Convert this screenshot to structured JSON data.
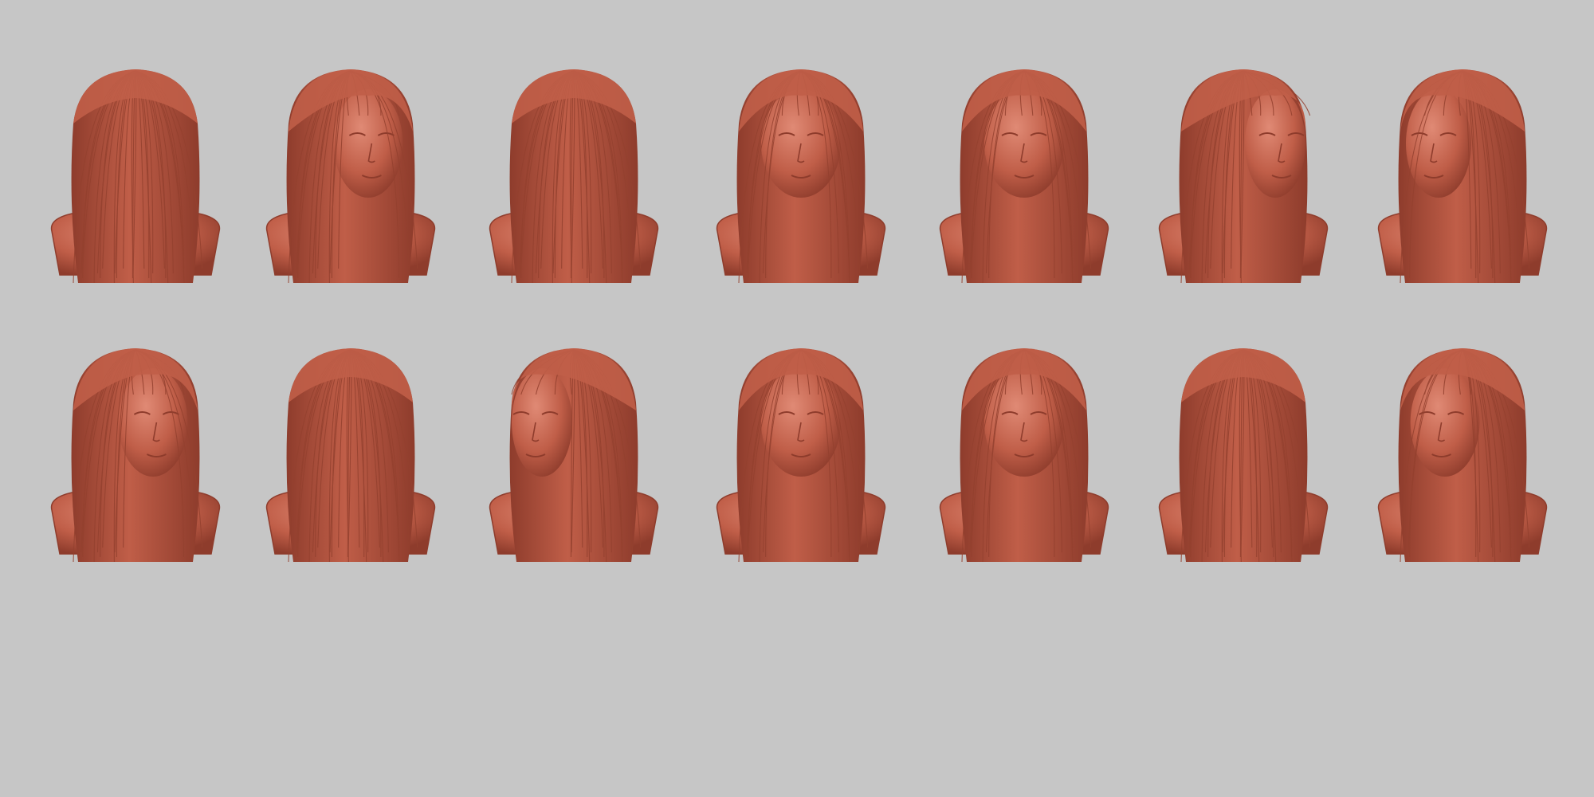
{
  "scene": {
    "background_color": "#c6c6c6",
    "clay_color": "#c05e48",
    "clay_dark_color": "#8e3c2c",
    "clay_light_color": "#e08a75",
    "strand_color": "#94412f",
    "rows": [
      {
        "name": "top-row",
        "busts": [
          {
            "view": "back"
          },
          {
            "view": "three-quarter-right"
          },
          {
            "view": "back-three-quarter-left"
          },
          {
            "view": "front-looking-up"
          },
          {
            "view": "front"
          },
          {
            "view": "profile-right"
          },
          {
            "view": "three-quarter-left-tilted"
          }
        ]
      },
      {
        "name": "bottom-row",
        "busts": [
          {
            "view": "three-quarter-right"
          },
          {
            "view": "back-three-quarter-right"
          },
          {
            "view": "profile-left"
          },
          {
            "view": "front-looking-down"
          },
          {
            "view": "front"
          },
          {
            "view": "top-down"
          },
          {
            "view": "three-quarter-left"
          }
        ]
      }
    ]
  }
}
